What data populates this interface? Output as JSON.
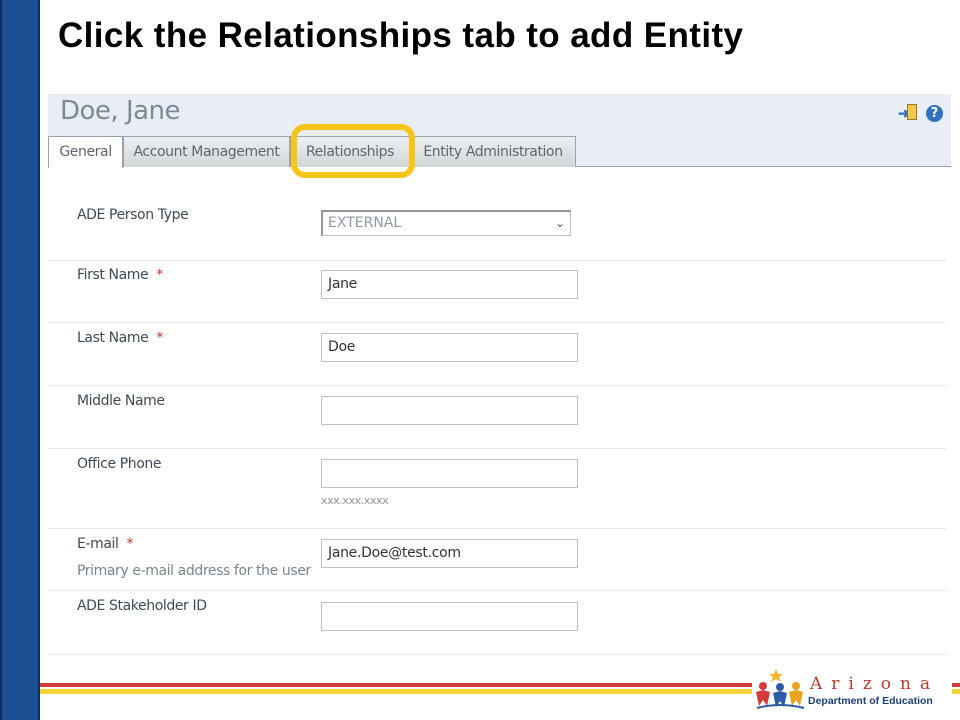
{
  "slide": {
    "title": "Click the Relationships tab to add Entity"
  },
  "app": {
    "record_name": "Doe, Jane",
    "header_icons": [
      "action-icon",
      "help-icon"
    ],
    "tabs": [
      {
        "label": "General",
        "active": true
      },
      {
        "label": "Account Management",
        "active": false
      },
      {
        "label": "Relationships",
        "active": false,
        "highlighted": true
      },
      {
        "label": "Entity Administration",
        "active": false
      }
    ]
  },
  "form": {
    "person_type": {
      "label": "ADE Person Type",
      "value": "EXTERNAL"
    },
    "first_name": {
      "label": "First Name",
      "required_mark": "*",
      "value": "Jane"
    },
    "last_name": {
      "label": "Last Name",
      "required_mark": "*",
      "value": "Doe"
    },
    "middle_name": {
      "label": "Middle Name",
      "value": ""
    },
    "office_phone": {
      "label": "Office Phone",
      "value": "",
      "hint": "xxx.xxx.xxxx"
    },
    "email": {
      "label": "E-mail",
      "required_mark": "*",
      "description": "Primary e-mail address for the user",
      "value": "Jane.Doe@test.com"
    },
    "stakeholder_id": {
      "label": "ADE Stakeholder ID",
      "value": ""
    }
  },
  "logo": {
    "name": "Arizona",
    "subtitle": "Department of Education"
  },
  "colors": {
    "left_bar": "#1d4f95",
    "highlight": "#f5c518",
    "required": "#c0392b",
    "footer_red": "#d23c3c",
    "footer_yellow": "#f3d43a"
  }
}
